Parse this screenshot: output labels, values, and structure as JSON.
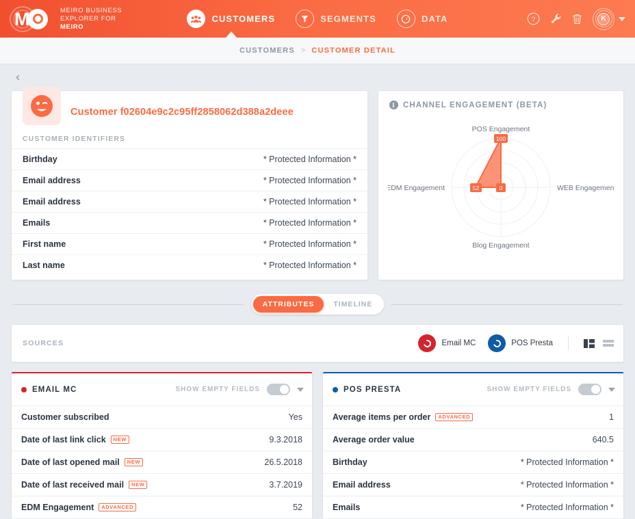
{
  "brand": {
    "line1": "MEIRO BUSINESS",
    "line2": "EXPLORER FOR",
    "line3": "MEIRO",
    "logo_icon": "meiro-logo-icon"
  },
  "nav": {
    "items": [
      {
        "label": "CUSTOMERS",
        "icon": "people-icon",
        "active": true
      },
      {
        "label": "SEGMENTS",
        "icon": "funnel-icon",
        "active": false
      },
      {
        "label": "DATA",
        "icon": "gauge-icon",
        "active": false
      }
    ],
    "actions": [
      {
        "name": "help-icon",
        "glyph": "?"
      },
      {
        "name": "wrench-icon",
        "glyph": "wrench"
      },
      {
        "name": "trash-icon",
        "glyph": "trash"
      }
    ],
    "avatar_initial": "K"
  },
  "breadcrumb": {
    "parent": "CUSTOMERS",
    "separator": ">",
    "current": "CUSTOMER DETAIL"
  },
  "customer": {
    "title": "Customer f02604e9c2c95ff2858062d388a2deee",
    "avatar_icon": "winking-smiley-icon",
    "identifiers_label": "CUSTOMER IDENTIFIERS",
    "identifiers": [
      {
        "key": "Birthday",
        "value": "* Protected Information *"
      },
      {
        "key": "Email address",
        "value": "* Protected Information *"
      },
      {
        "key": "Email address",
        "value": "* Protected Information *"
      },
      {
        "key": "Emails",
        "value": "* Protected Information *"
      },
      {
        "key": "First name",
        "value": "* Protected Information *"
      },
      {
        "key": "Last name",
        "value": "* Protected Information *"
      }
    ]
  },
  "engagement_panel": {
    "title": "CHANNEL ENGAGEMENT (BETA)",
    "info_icon": "info-icon"
  },
  "chart_data": {
    "type": "radar",
    "title": "CHANNEL ENGAGEMENT (BETA)",
    "categories": [
      "POS Engagement",
      "WEB Engagement",
      "Blog Engagement",
      "EDM Engagement"
    ],
    "values": [
      100,
      0,
      0,
      52
    ],
    "value_labels": [
      "100",
      "0",
      "",
      "52"
    ],
    "rmin": 0,
    "rmax": 100,
    "rings": 4,
    "grid": true,
    "legend": "none",
    "series_color": "#fa6a43",
    "fill_opacity": 0.75
  },
  "tabs": {
    "items": [
      {
        "label": "ATTRIBUTES",
        "active": true
      },
      {
        "label": "TIMELINE",
        "active": false
      }
    ]
  },
  "sources_bar": {
    "label": "SOURCES",
    "chips": [
      {
        "name": "Email MC",
        "color": "#d5232e",
        "icon": "email-mc-icon"
      },
      {
        "name": "POS Presta",
        "color": "#0e5ca8",
        "icon": "pos-presta-icon"
      }
    ],
    "view_toggles": [
      {
        "name": "column-view-toggle",
        "active": true
      },
      {
        "name": "list-view-toggle",
        "active": false
      }
    ]
  },
  "panels": [
    {
      "title": "EMAIL MC",
      "accent": "#d5232e",
      "show_empty_label": "SHOW EMPTY FIELDS",
      "show_empty_on": false,
      "rows": [
        {
          "key": "Customer subscribed",
          "tag": "",
          "value": "Yes"
        },
        {
          "key": "Date of last link click",
          "tag": "NEW",
          "value": "9.3.2018"
        },
        {
          "key": "Date of last opened mail",
          "tag": "NEW",
          "value": "26.5.2018"
        },
        {
          "key": "Date of last received mail",
          "tag": "NEW",
          "value": "3.7.2019"
        },
        {
          "key": "EDM Engagement",
          "tag": "ADVANCED",
          "value": "52"
        }
      ]
    },
    {
      "title": "POS PRESTA",
      "accent": "#0e5ca8",
      "show_empty_label": "SHOW EMPTY FIELDS",
      "show_empty_on": false,
      "rows": [
        {
          "key": "Average items per order",
          "tag": "ADVANCED",
          "value": "1"
        },
        {
          "key": "Average order value",
          "tag": "",
          "value": "640.5"
        },
        {
          "key": "Birthday",
          "tag": "",
          "value": "* Protected Information *"
        },
        {
          "key": "Email address",
          "tag": "",
          "value": "* Protected Information *"
        },
        {
          "key": "Emails",
          "tag": "",
          "value": "* Protected Information *"
        }
      ]
    }
  ]
}
